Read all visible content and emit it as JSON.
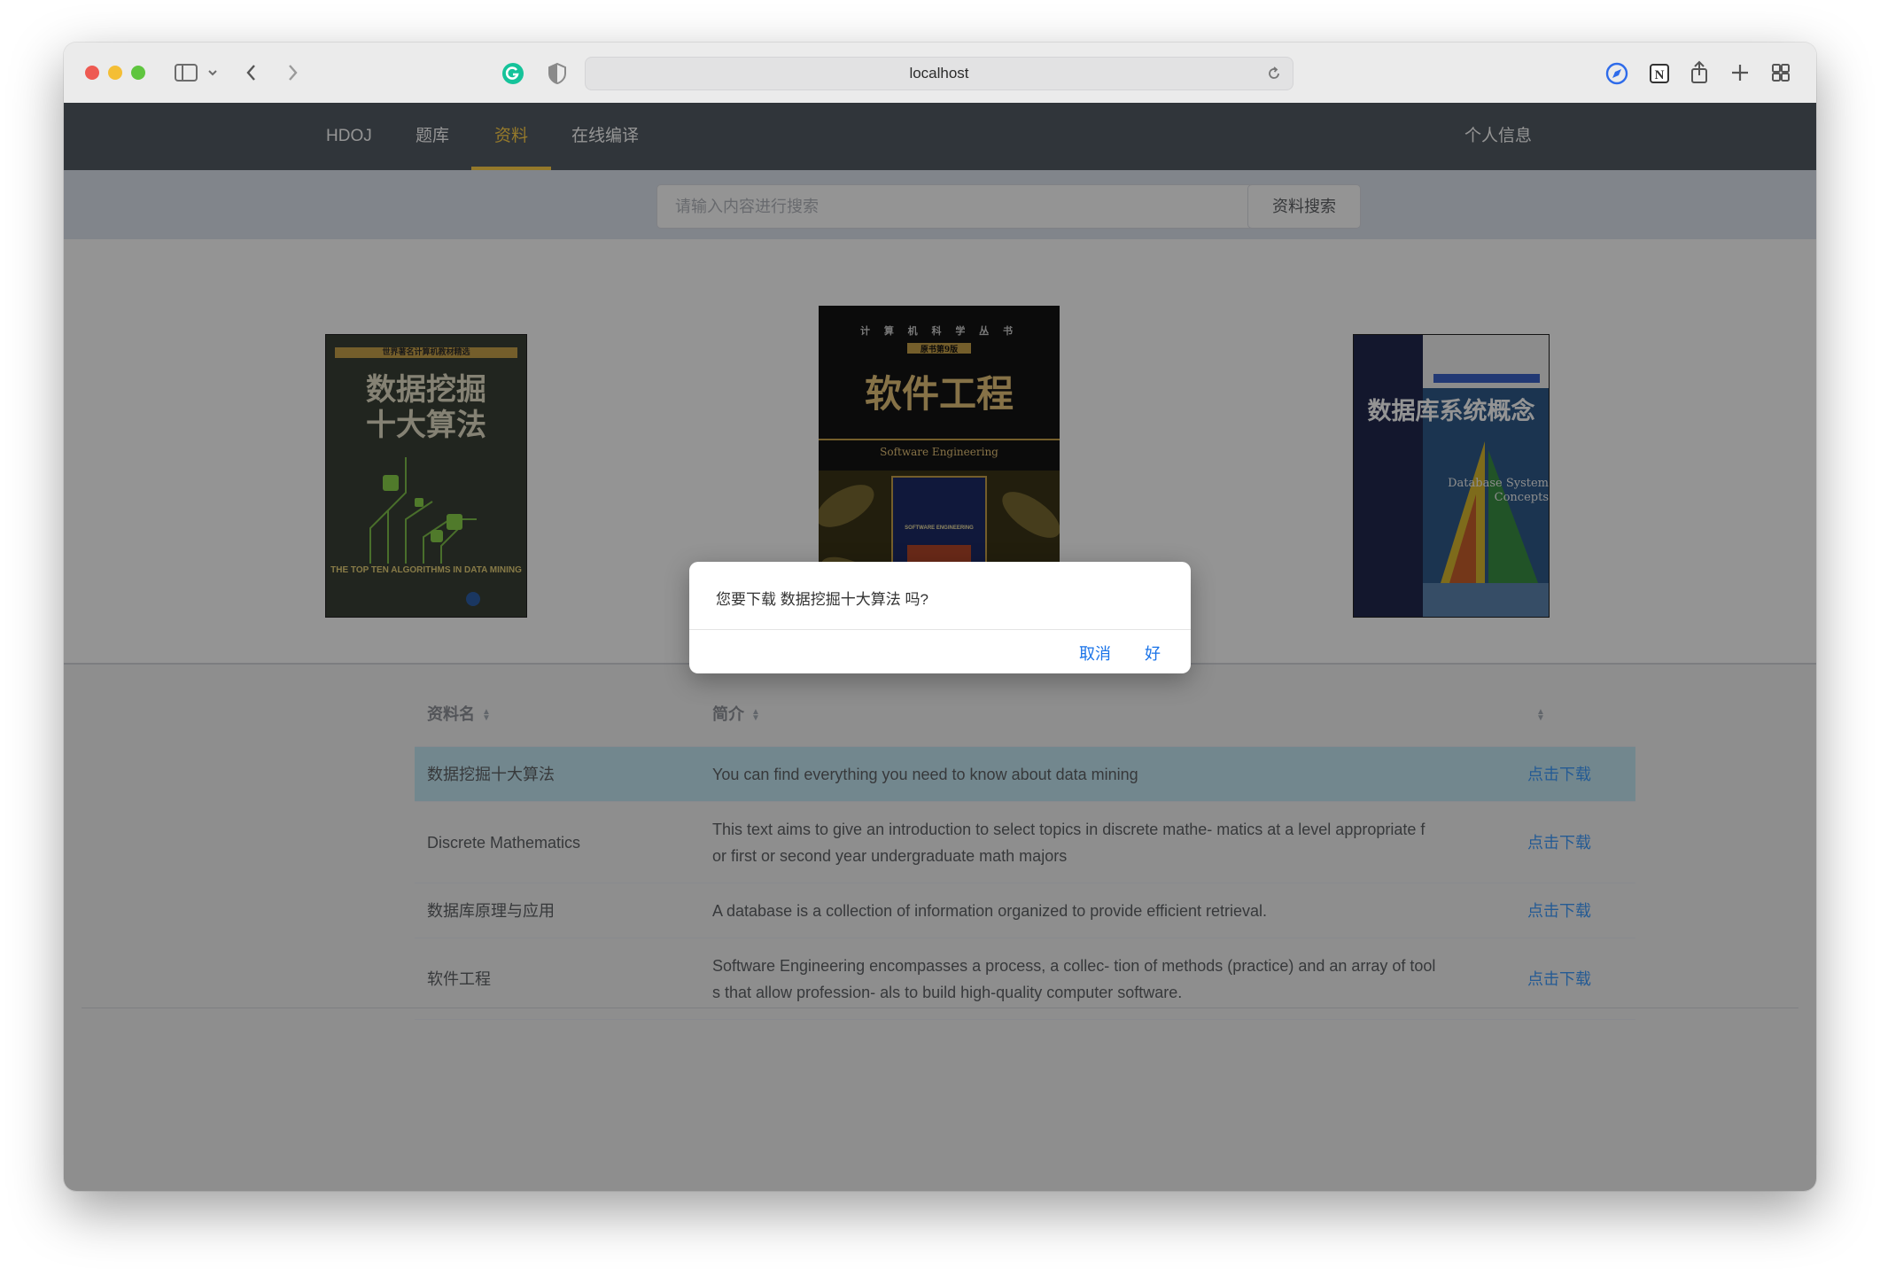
{
  "browser": {
    "address": "localhost"
  },
  "nav": {
    "items": [
      "HDOJ",
      "题库",
      "资料",
      "在线编译"
    ],
    "active_index": 2,
    "profile": "个人信息",
    "active_color": "#ffd04b",
    "bar_color": "#545c64"
  },
  "search": {
    "placeholder": "请输入内容进行搜索",
    "value": "",
    "button": "资料搜索"
  },
  "carousel": {
    "books": [
      {
        "series": "世界著名计算机教材精选",
        "title_line1": "数据挖掘",
        "title_line2": "十大算法",
        "subtitle": "THE TOP TEN ALGORITHMS IN DATA MINING"
      },
      {
        "series": "计 算 机 科 学 丛 书",
        "edition": "原书第9版",
        "title": "软件工程",
        "subtitle": "Software Engineering",
        "inner": "SOFTWARE ENGINEERING"
      },
      {
        "title": "数据库系统概念",
        "subtitle_line1": "Database System",
        "subtitle_line2": "Concepts"
      }
    ]
  },
  "table": {
    "headers": [
      "资料名",
      "简介",
      ""
    ],
    "rows": [
      {
        "name": "数据挖掘十大算法",
        "intro_line1": "You can find everything you need to know about data mining",
        "intro_line2": "",
        "action": "点击下载",
        "highlighted": true
      },
      {
        "name": "Discrete Mathematics",
        "intro_line1": "This text aims to give an introduction to select topics in discrete mathe- matics at a level appropriate f",
        "intro_line2": "or first or second year undergraduate math majors",
        "action": "点击下载",
        "highlighted": false
      },
      {
        "name": "数据库原理与应用",
        "intro_line1": "A database is a collection of information organized to provide efficient retrieval.",
        "intro_line2": "",
        "action": "点击下载",
        "highlighted": false
      },
      {
        "name": "软件工程",
        "intro_line1": "Software Engineering encompasses a process, a collec- tion of methods (practice) and an array of tool",
        "intro_line2": "s that allow profession- als to build high-quality computer software.",
        "action": "点击下载",
        "highlighted": false
      }
    ]
  },
  "dialog": {
    "message": "您要下载 数据挖掘十大算法 吗?",
    "cancel": "取消",
    "ok": "好"
  }
}
